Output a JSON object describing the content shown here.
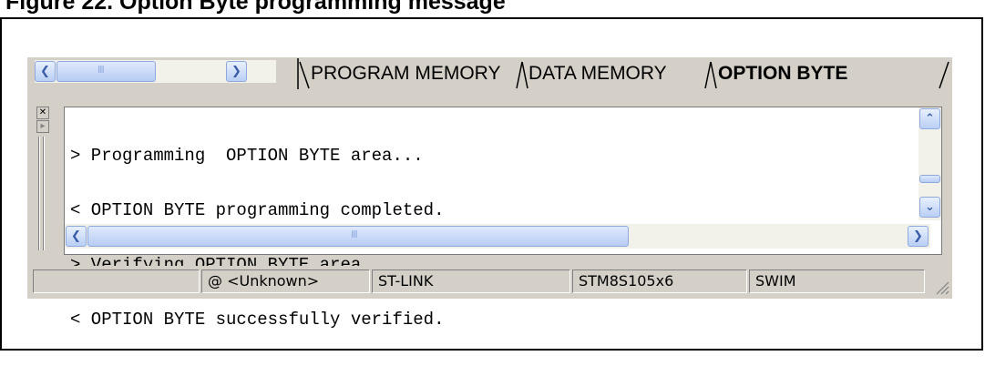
{
  "caption": "Figure 22. Option Byte programming message",
  "tabs": [
    {
      "label": "PROGRAM MEMORY",
      "active": false
    },
    {
      "label": "DATA MEMORY",
      "active": false
    },
    {
      "label": "OPTION BYTE",
      "active": true
    }
  ],
  "tab_scroll_grip": "III",
  "log": {
    "lines": [
      "> Programming  OPTION BYTE area...",
      "< OPTION BYTE programming completed.",
      "> Verifying OPTION BYTE area...",
      "< OPTION BYTE successfully verified."
    ],
    "hscroll_grip": "III"
  },
  "statusbar": {
    "address": "@ <Unknown>",
    "probe": "ST-LINK",
    "device": "STM8S105x6",
    "protocol": "SWIM"
  },
  "icons": {
    "scroll_left": "chevron-left-icon",
    "scroll_right": "chevron-right-icon",
    "scroll_up": "chevron-up-icon",
    "scroll_down": "chevron-down-icon",
    "close": "close-icon"
  },
  "colors": {
    "window_bg": "#d4d0c8",
    "scroll_button": "#b9cff4",
    "scroll_track": "#f2f1ea"
  }
}
